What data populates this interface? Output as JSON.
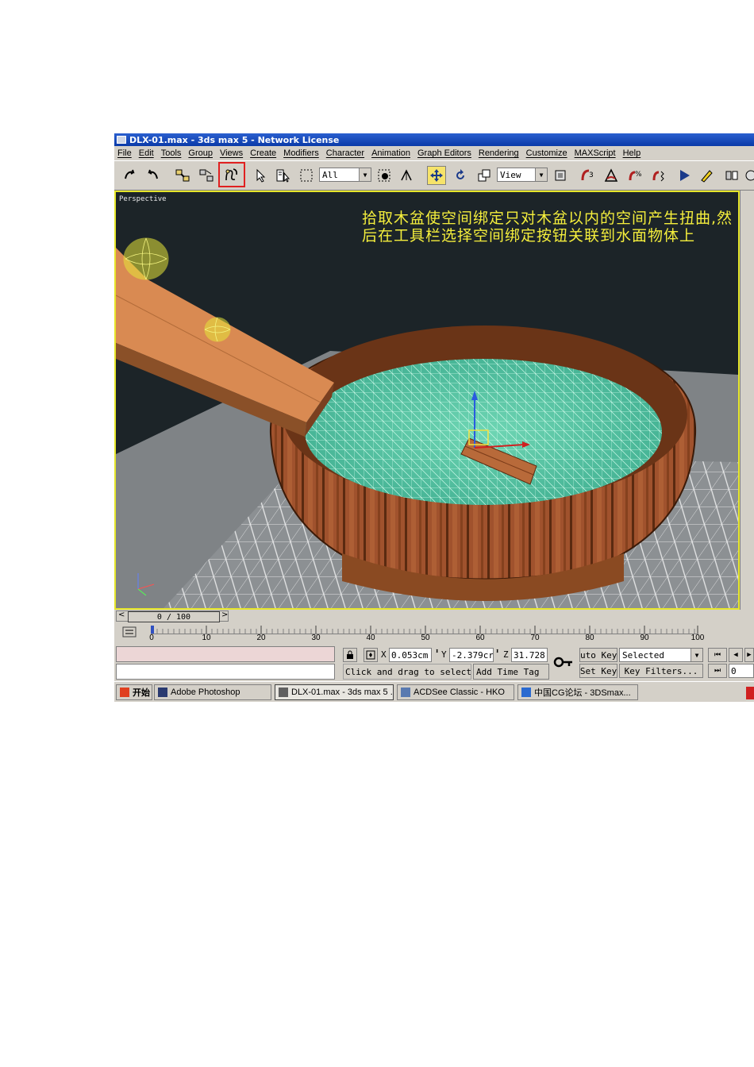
{
  "window": {
    "title": "DLX-01.max - 3ds max 5 - Network License"
  },
  "menu": [
    "File",
    "Edit",
    "Tools",
    "Group",
    "Views",
    "Create",
    "Modifiers",
    "Character",
    "Animation",
    "Graph Editors",
    "Rendering",
    "Customize",
    "MAXScript",
    "Help"
  ],
  "toolbar": {
    "selection_filter": "All",
    "coord_system": "View",
    "icons": [
      "undo-icon",
      "redo-icon",
      "select-and-link-icon",
      "unlink-icon",
      "bind-to-space-warp-icon",
      "select-object-icon",
      "select-by-name-icon",
      "rectangular-selection-icon",
      "window-crossing-icon",
      "select-and-move-icon",
      "select-and-rotate-icon",
      "select-and-scale-icon",
      "use-pivot-icon",
      "snap-3d-icon",
      "angle-snap-icon",
      "percent-snap-icon",
      "spinner-snap-icon",
      "play-icon",
      "named-selection-icon",
      "mirror-icon",
      "align-icon"
    ]
  },
  "viewport": {
    "label": "Perspective",
    "caption": "拾取木盆使空间绑定只对木盆以内的空间产生扭曲,然后在工具栏选择空间绑定按钮关联到水面物体上"
  },
  "timeslider": {
    "position": "0 / 100"
  },
  "trackbar": {
    "ticks": [
      "0",
      "10",
      "20",
      "30",
      "40",
      "50",
      "60",
      "70",
      "80",
      "90",
      "100"
    ]
  },
  "status": {
    "x_value": "0.053cm",
    "y_value": "-2.379cr",
    "z_value": "31.728",
    "prompt": "Click and drag to select",
    "add_time_tag": "Add Time Tag",
    "auto_key": "uto Key",
    "set_key": "Set Key",
    "key_mode": "Selected",
    "key_filters": "Key Filters...",
    "frame": "0"
  },
  "taskbar": {
    "start": "开始",
    "tasks": [
      "Adobe Photoshop",
      "DLX-01.max - 3ds max 5 ...",
      "ACDSee Classic - HKO",
      "中国CG论坛 - 3DSmax..."
    ]
  },
  "colors": {
    "caption": "#f4ee3c",
    "viewport_border": "#e6e62a",
    "water": "#5fc9a6",
    "tub": "#a0522d",
    "highlight": "#e02020"
  }
}
